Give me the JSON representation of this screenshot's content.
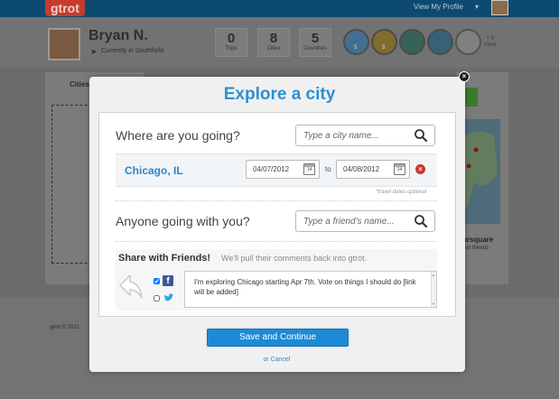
{
  "app": {
    "logo_text": "gtrot",
    "nav_view_profile": "View My Profile",
    "nav_caret": "▾"
  },
  "profile": {
    "name": "Bryan N.",
    "location": "Currently in Southfield",
    "stats": [
      {
        "value": "0",
        "label": "Trips"
      },
      {
        "value": "8",
        "label": "Cities"
      },
      {
        "value": "5",
        "label": "Countries"
      }
    ],
    "badges": [
      {
        "icon": "passport-badge-icon",
        "count": "5",
        "color": "#2f6f9f"
      },
      {
        "icon": "city-badge-icon",
        "count": "5",
        "color": "#8a6a10"
      },
      {
        "icon": "globe-badge-icon",
        "count": "",
        "color": "#1e5c4e"
      },
      {
        "icon": "globe-badge-icon",
        "count": "",
        "color": "#1f5a7a"
      },
      {
        "icon": "locked-badge-icon",
        "count": "",
        "color": "#8a8a8a"
      }
    ],
    "more_count": "+ 0",
    "more_label": "more"
  },
  "background": {
    "cities_tab": "Cities",
    "foursquare_label": "ursquare",
    "foursquare_sub": "rom friends",
    "footer": "gtrot © 2011"
  },
  "modal": {
    "title": "Explore a city",
    "close_label": "×",
    "destination": {
      "label": "Where are you going?",
      "placeholder": "Type a city name..."
    },
    "trip": {
      "city": "Chicago, IL",
      "start_date": "04/07/2012",
      "end_date": "04/08/2012",
      "to_label": "to",
      "calendar_glyph": "14",
      "remove_glyph": "×",
      "dates_note": "*travel dates optional"
    },
    "companions": {
      "label": "Anyone going with you?",
      "placeholder": "Type a friend's name..."
    },
    "share": {
      "title": "Share with Friends!",
      "subtitle": "We'll pull their comments back into gtrot.",
      "facebook_checked": true,
      "twitter_checked": false,
      "facebook_glyph": "f",
      "message": "I'm exploring Chicago starting Apr 7th. Vote on things I should do [link will be added]"
    },
    "save_label": "Save and Continue",
    "cancel_label": "or Cancel"
  },
  "colors": {
    "accent_blue": "#2e8fd3",
    "save_button": "#1e8ad6",
    "remove_red": "#d0342c",
    "facebook": "#3b5998",
    "twitter": "#29a9e0"
  }
}
